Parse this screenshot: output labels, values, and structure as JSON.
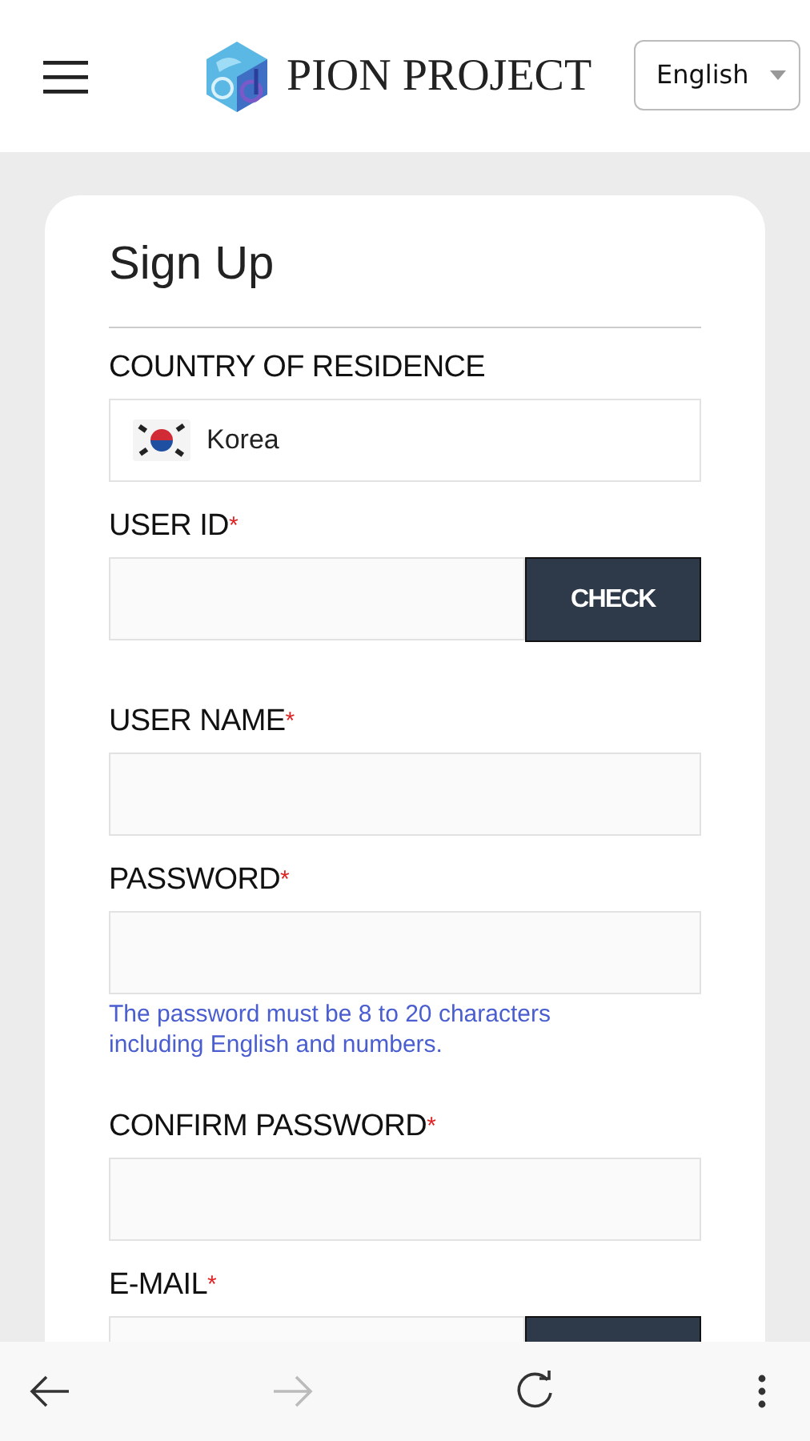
{
  "header": {
    "brand": "PION PROJECT",
    "language": "English"
  },
  "form": {
    "title": "Sign Up",
    "fields": [
      {
        "kind": "country",
        "label": "COUNTRY OF RESIDENCE",
        "value": "Korea"
      },
      {
        "kind": "with_button",
        "label": "USER ID",
        "required_mark": "*",
        "button": "CHECK"
      },
      {
        "kind": "text",
        "label": "USER NAME",
        "required_mark": "*"
      },
      {
        "kind": "text",
        "label": "PASSWORD",
        "required_mark": "*",
        "hint": "The password must be 8 to 20 characters including English and numbers."
      },
      {
        "kind": "text",
        "label": "CONFIRM PASSWORD",
        "required_mark": "*"
      },
      {
        "kind": "with_button",
        "label": "E-MAIL",
        "required_mark": "*"
      }
    ]
  },
  "browser_bar": {
    "forward_disabled": true
  }
}
